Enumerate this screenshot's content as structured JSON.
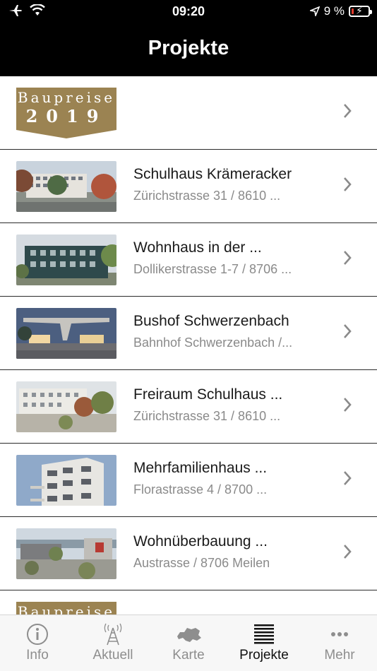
{
  "status_bar": {
    "time": "09:20",
    "battery_percent": "9 %"
  },
  "nav": {
    "title": "Projekte"
  },
  "banner": {
    "line1": "Baupreise",
    "line2": "2019"
  },
  "projects": [
    {
      "title": "Schulhaus Krämeracker",
      "subtitle": "Zürichstrasse 31  /  8610 ..."
    },
    {
      "title": "Wohnhaus in der ...",
      "subtitle": "Dollikerstrasse 1-7 / 8706 ..."
    },
    {
      "title": "Bushof Schwerzenbach",
      "subtitle": "Bahnhof Schwerzenbach  /..."
    },
    {
      "title": "Freiraum Schulhaus ...",
      "subtitle": "Zürichstrasse 31  /  8610 ..."
    },
    {
      "title": "Mehrfamilienhaus ...",
      "subtitle": "Florastrasse 4  /  8700 ..."
    },
    {
      "title": "Wohnüberbauung ...",
      "subtitle": "Austrasse  /  8706 Meilen"
    }
  ],
  "banner_bottom": {
    "line1": "Baupreise"
  },
  "tabs": [
    {
      "label": "Info",
      "icon": "info-icon"
    },
    {
      "label": "Aktuell",
      "icon": "antenna-icon"
    },
    {
      "label": "Karte",
      "icon": "switzerland-map-icon"
    },
    {
      "label": "Projekte",
      "icon": "list-lines-icon"
    },
    {
      "label": "Mehr",
      "icon": "more-dots-icon"
    }
  ],
  "colors": {
    "header_bg": "#000000",
    "badge_gold": "#9b8352",
    "active_tab": "#111111",
    "inactive_tab": "#8e8e8e"
  }
}
